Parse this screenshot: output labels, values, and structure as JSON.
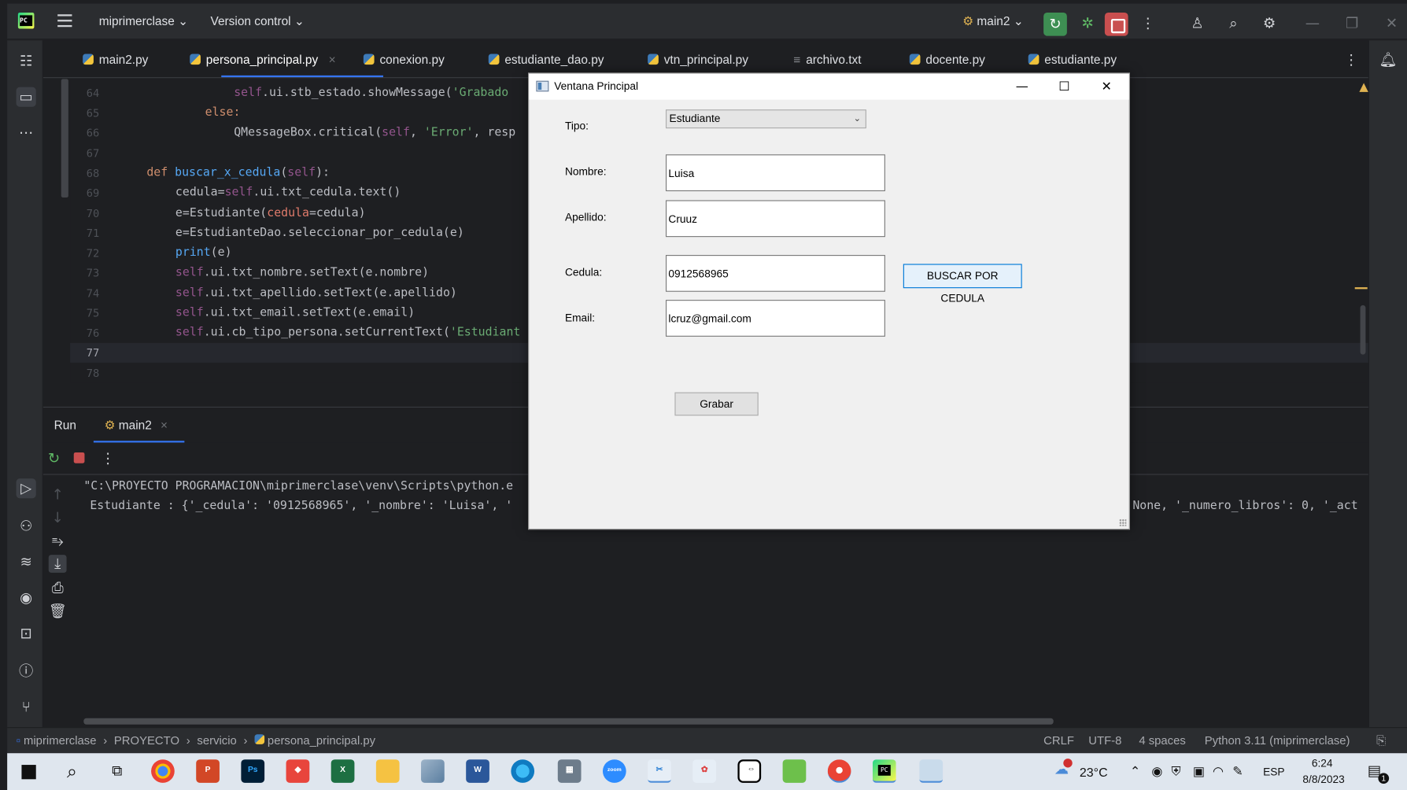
{
  "ide": {
    "project_name": "miprimerclase",
    "version_control": "Version control",
    "run_config": "main2"
  },
  "tabs": [
    {
      "label": "main2.py"
    },
    {
      "label": "persona_principal.py"
    },
    {
      "label": "conexion.py"
    },
    {
      "label": "estudiante_dao.py"
    },
    {
      "label": "vtn_principal.py"
    },
    {
      "label": "archivo.txt"
    },
    {
      "label": "docente.py"
    },
    {
      "label": "estudiante.py"
    }
  ],
  "editor": {
    "line_numbers": [
      "64",
      "65",
      "66",
      "67",
      "68",
      "69",
      "70",
      "71",
      "72",
      "73",
      "74",
      "75",
      "76",
      "77",
      "78"
    ],
    "code": {
      "l64a": "self",
      "l64b": ".ui.stb_estado.showMessage(",
      "l64c": "'Grabado",
      "l65": "else:",
      "l66a": "QMessageBox.critical(",
      "l66b": "self",
      "l66c": ", ",
      "l66d": "'Error'",
      "l66e": ", resp",
      "l68a": "def ",
      "l68b": "buscar_x_cedula",
      "l68c": "(",
      "l68d": "self",
      "l68e": "):",
      "l69a": "cedula=",
      "l69b": "self",
      "l69c": ".ui.txt_cedula.text()",
      "l70a": "e=Estudiante(",
      "l70b": "cedula",
      "l70c": "=cedula)",
      "l71": "e=EstudianteDao.seleccionar_por_cedula(e)",
      "l72a": "print",
      "l72b": "(e)",
      "l73a": "self",
      "l73b": ".ui.txt_nombre.setText(e.nombre)",
      "l74a": "self",
      "l74b": ".ui.txt_apellido.setText(e.apellido)",
      "l75a": "self",
      "l75b": ".ui.txt_email.setText(e.email)",
      "l76a": "self",
      "l76b": ".ui.cb_tipo_persona.setCurrentText(",
      "l76c": "'Estudiant"
    }
  },
  "run_panel": {
    "run_label": "Run",
    "tab_label": "main2",
    "output_line1": "\"C:\\PROYECTO PROGRAMACION\\miprimerclase\\venv\\Scripts\\python.e",
    "output_line2": "Estudiante : {'_cedula': '0912568965', '_nombre': 'Luisa', '",
    "output_line2_right": "None, '_numero_libros': 0, '_act"
  },
  "statusbar": {
    "breadcrumb": [
      "miprimerclase",
      "PROYECTO",
      "servicio",
      "persona_principal.py"
    ],
    "line_ending": "CRLF",
    "encoding": "UTF-8",
    "indent": "4 spaces",
    "interpreter": "Python 3.11 (miprimerclase)"
  },
  "taskbar": {
    "weather": "23°C",
    "language": "ESP",
    "time": "6:24",
    "date": "8/8/2023",
    "notification_count": "1"
  },
  "dialog": {
    "title": "Ventana Principal",
    "tipo_label": "Tipo:",
    "tipo_value": "Estudiante",
    "nombre_label": "Nombre:",
    "nombre_value": "Luisa",
    "apellido_label": "Apellido:",
    "apellido_value": "Cruuz",
    "cedula_label": "Cedula:",
    "cedula_value": "0912568965",
    "buscar_button": "BUSCAR POR CEDULA",
    "email_label": "Email:",
    "email_value": "lcruz@gmail.com",
    "grabar_button": "Grabar"
  },
  "colors": {
    "ide_background": "#1e1f22",
    "keyword": "#cf8e6d",
    "self": "#94558d",
    "string": "#6aab73",
    "function": "#56a8f5",
    "accent": "#3574f0"
  }
}
